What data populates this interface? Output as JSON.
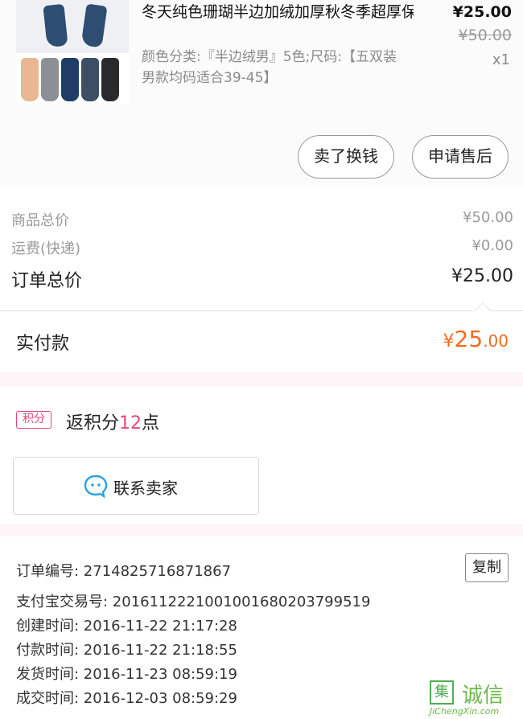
{
  "product": {
    "title": "冬天纯色珊瑚半边加绒加厚秋冬季超厚保暖毛圈毛巾底中筒男袜子…",
    "spec": "颜色分类:『半边绒男』5色;尺码:【五双装 男款均码适合39-45】",
    "price": "¥25.00",
    "original_price": "¥50.00",
    "quantity": "x1",
    "buttons": {
      "cash": "卖了换钱",
      "after_sale": "申请售后"
    }
  },
  "summary": {
    "goods_total_label": "商品总价",
    "goods_total_value": "¥50.00",
    "shipping_label": "运费(快递)",
    "shipping_value": "¥0.00",
    "order_total_label": "订单总价",
    "order_total_value": "¥25.00"
  },
  "paid": {
    "label": "实付款",
    "currency": "¥",
    "integer": "25",
    "decimal": ".00"
  },
  "points": {
    "badge": "积分",
    "text_before": "返积分",
    "number": "12",
    "text_after": "点"
  },
  "contact": {
    "label": "联系卖家"
  },
  "order_info": {
    "copy_label": "复制",
    "order_no": "订单编号: 2714825716871867",
    "alipay_no": "支付宝交易号: 2016112221001001680203799519",
    "created": "创建时间: 2016-11-22 21:17:28",
    "paid": "付款时间: 2016-11-22 21:18:55",
    "shipped": "发货时间: 2016-11-23 08:59:19",
    "completed": "成交时间: 2016-12-03 08:59:29"
  },
  "watermark": {
    "box": "集",
    "chars": "诚信",
    "url": "JiChengXin.com"
  },
  "colors": {
    "accent_pink": "#e8457d",
    "price_orange": "#f56a1b"
  }
}
